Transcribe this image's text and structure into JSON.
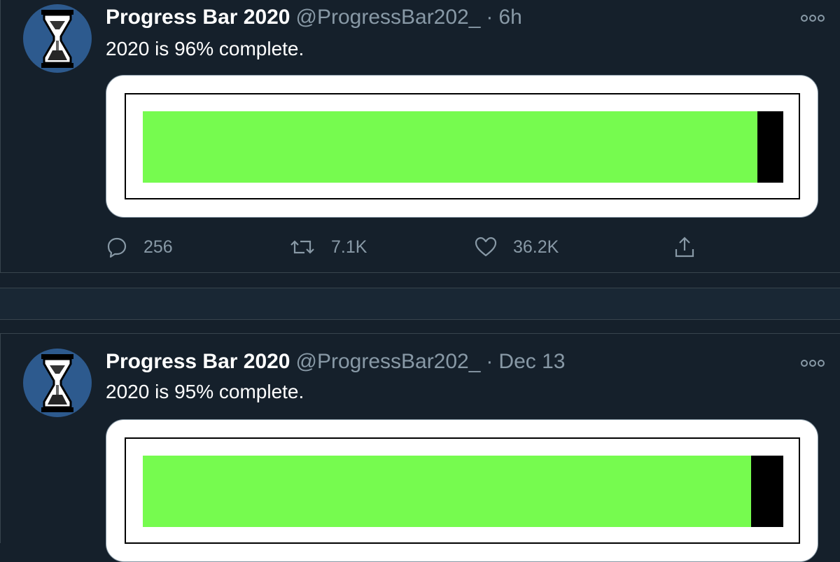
{
  "tweets": [
    {
      "name": "Progress Bar 2020",
      "handle": "@ProgressBar202_",
      "separator": "·",
      "time": "6h",
      "text": "2020 is 96% complete.",
      "progress_fraction": 0.96,
      "replies": "256",
      "retweets": "7.1K",
      "likes": "36.2K"
    },
    {
      "name": "Progress Bar 2020",
      "handle": "@ProgressBar202_",
      "separator": "·",
      "time": "Dec 13",
      "text": "2020 is 95% complete.",
      "progress_fraction": 0.95
    }
  ],
  "icons": {
    "more": "more-horizontal-icon",
    "reply": "reply-bubble-icon",
    "retweet": "retweet-icon",
    "like": "heart-icon",
    "share": "share-upload-icon"
  },
  "colors": {
    "background": "#15202b",
    "progress_fill": "#76fb4f",
    "progress_track": "#000000",
    "muted_text": "#8899a6"
  }
}
